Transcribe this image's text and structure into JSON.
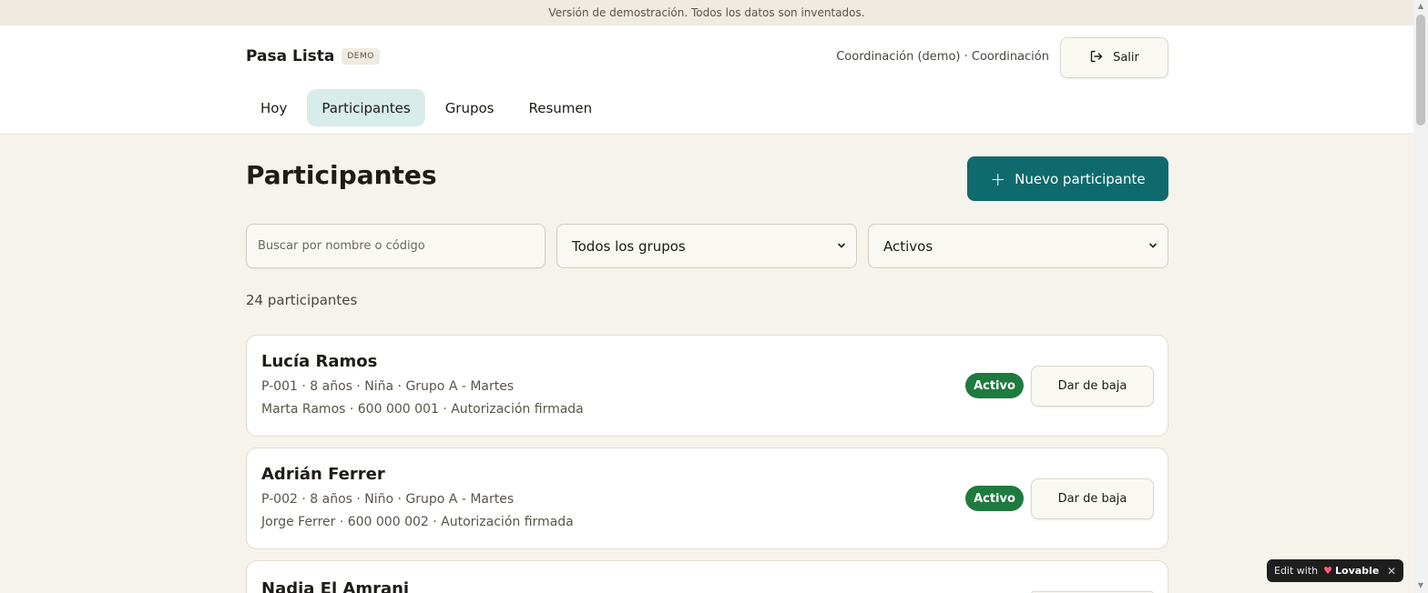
{
  "banner": "Versión de demostración. Todos los datos son inventados.",
  "header": {
    "brand": "Pasa Lista",
    "badge": "DEMO",
    "user": "Coordinación (demo) · Coordinación",
    "logout_label": "Salir"
  },
  "nav": {
    "tabs": [
      {
        "label": "Hoy",
        "active": false
      },
      {
        "label": "Participantes",
        "active": true
      },
      {
        "label": "Grupos",
        "active": false
      },
      {
        "label": "Resumen",
        "active": false
      }
    ]
  },
  "main": {
    "title": "Participantes",
    "new_button": "Nuevo participante",
    "search_placeholder": "Buscar por nombre o código",
    "group_filter": "Todos los grupos",
    "status_filter": "Activos",
    "count": "24 participantes",
    "participants": [
      {
        "name": "Lucía Ramos",
        "meta": "P-001 · 8 años · Niña · Grupo A - Martes",
        "contact": "Marta Ramos · 600 000 001 · Autorización firmada",
        "status": "Activo",
        "action": "Dar de baja"
      },
      {
        "name": "Adrián Ferrer",
        "meta": "P-002 · 8 años · Niño · Grupo A - Martes",
        "contact": "Jorge Ferrer · 600 000 002 · Autorización firmada",
        "status": "Activo",
        "action": "Dar de baja"
      },
      {
        "name": "Nadia El Amrani",
        "meta": "",
        "contact": "",
        "status": "",
        "action": ""
      }
    ]
  },
  "widget": {
    "prefix": "Edit with",
    "brand": "Lovable"
  },
  "colors": {
    "accent": "#0f6a6e",
    "active_tab": "#d8ecea",
    "status_active": "#1f7a3f",
    "background": "#f6f3ec"
  }
}
